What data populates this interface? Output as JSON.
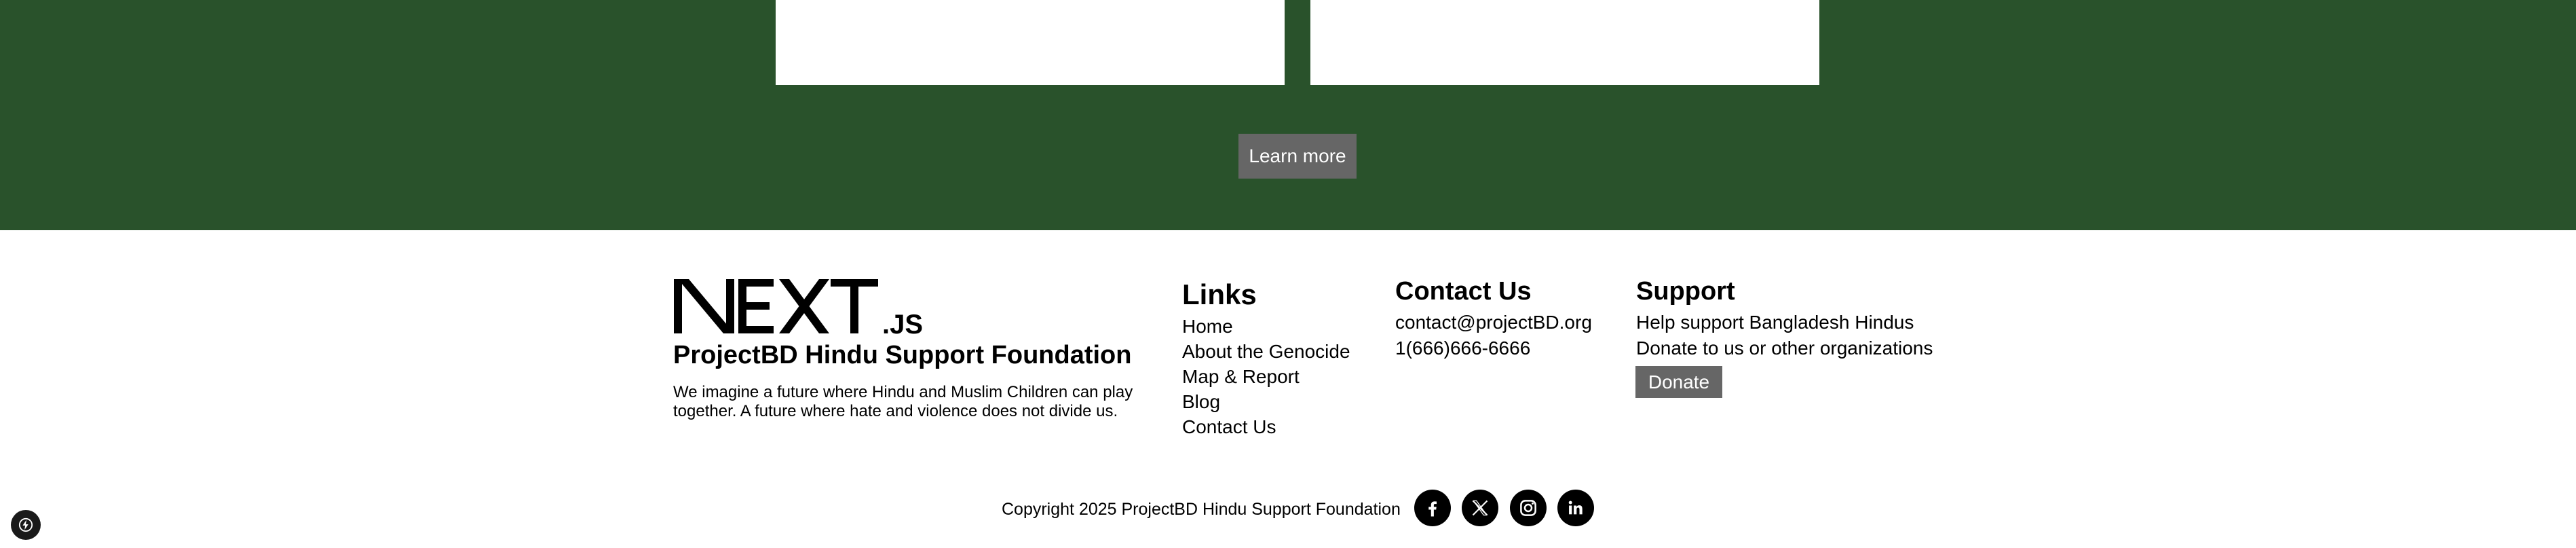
{
  "hero": {
    "learn_more_label": "Learn more",
    "background_color": "#29522b"
  },
  "footer": {
    "logo": {
      "text": "NEXT.JS",
      "icon": "nextjs-logo"
    },
    "org_name": "ProjectBD Hindu Support Foundation",
    "org_description": "We imagine a future where Hindu and Muslim Children can play together. A future where hate and violence does not divide us.",
    "links": {
      "title": "Links",
      "items": [
        {
          "label": "Home"
        },
        {
          "label": "About the Genocide"
        },
        {
          "label": "Map & Report"
        },
        {
          "label": "Blog"
        },
        {
          "label": "Contact Us"
        }
      ]
    },
    "contact": {
      "title": "Contact Us",
      "email": "contact@projectBD.org",
      "phone": "1(666)666-6666"
    },
    "support": {
      "title": "Support",
      "line1": "Help support Bangladesh Hindus",
      "line2": "Donate to us or other organizations",
      "donate_label": "Donate"
    },
    "copyright": "Copyright 2025 ProjectBD Hindu Support Foundation",
    "social": [
      {
        "icon": "facebook-icon"
      },
      {
        "icon": "x-twitter-icon"
      },
      {
        "icon": "instagram-icon"
      },
      {
        "icon": "linkedin-icon"
      }
    ],
    "button_color": "#666666"
  },
  "dev_badge": {
    "icon": "nextjs-dev-indicator-icon"
  }
}
